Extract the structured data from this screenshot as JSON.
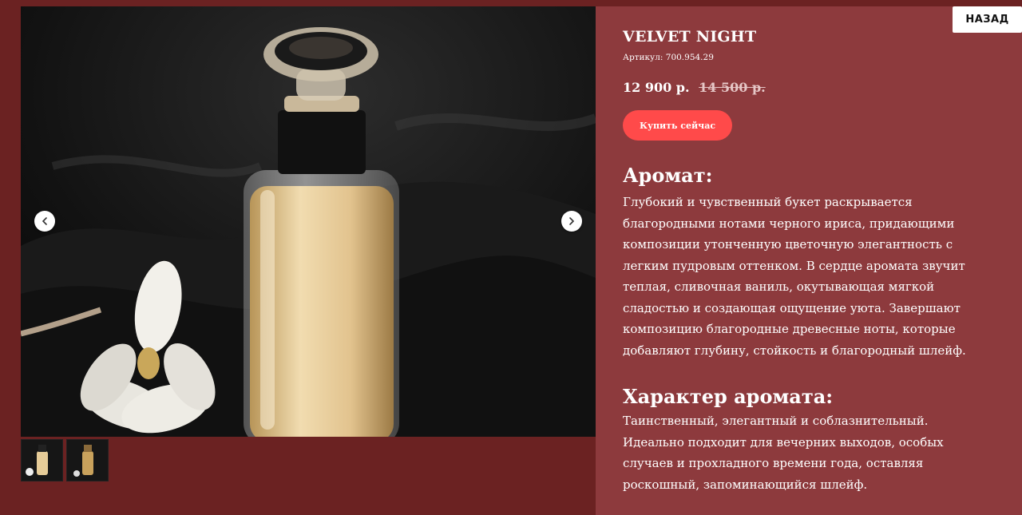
{
  "gallery": {
    "main_image": "perfume-bottle-photo",
    "prev_icon": "chevron-left-icon",
    "next_icon": "chevron-right-icon",
    "thumbnails": [
      "thumbnail-1",
      "thumbnail-2"
    ]
  },
  "header": {
    "back_label": "НАЗАД"
  },
  "product": {
    "name": "VELVET NIGHT",
    "sku": "Артикул: 700.954.29",
    "price": "12 900 р.",
    "old_price": "14 500 р.",
    "buy_label": "Купить сейчас"
  },
  "sections": {
    "aroma_heading": "Аромат:",
    "aroma_text": "Глубокий и чувственный букет раскрывается благородными нотами черного ириса, придающими композиции утонченную цветочную элегантность с легким пудровым оттенком. В сердце аромата звучит теплая, сливочная ваниль, окутывающая мягкой сладостью и создающая ощущение уюта. Завершают композицию благородные древесные ноты, которые добавляют глубину, стойкость и благородный шлейф.",
    "character_heading": "Характер аромата:",
    "character_text": "Таинственный, элегантный и соблазнительный. Идеально подходит для вечерних выходов, особых случаев и прохладного времени года, оставляя роскошный, запоминающийся шлейф."
  },
  "colors": {
    "page_bg": "#6b2222",
    "panel_bg": "#8d3a3d",
    "buy_button": "#ff4a4a"
  }
}
